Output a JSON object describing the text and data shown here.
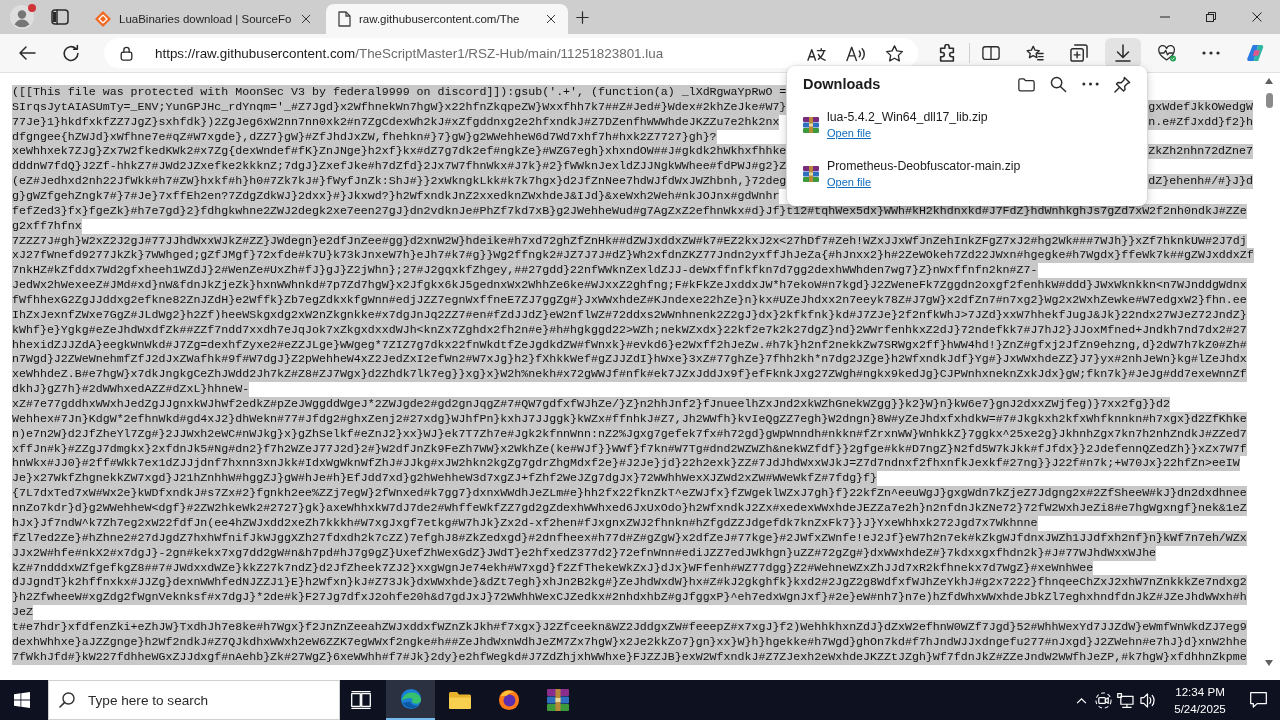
{
  "browser": {
    "profile": {
      "alert": true
    },
    "tabs": [
      {
        "kind": "site",
        "title": "LuaBinaries download | SourceFo",
        "selected": false
      },
      {
        "kind": "file",
        "title": "raw.githubusercontent.com/The",
        "selected": true
      }
    ],
    "address": {
      "origin": "https://raw.githubusercontent.com",
      "path": "/TheScriptMaster1/RSZ-Hub/main/11251823801.lua"
    },
    "field_actions": [
      {
        "kind": "translate"
      },
      {
        "kind": "read-aloud"
      },
      {
        "kind": "favorite"
      }
    ],
    "toolbar": [
      {
        "kind": "extensions",
        "selected": false
      },
      {
        "kind": "split",
        "selected": false
      },
      {
        "kind": "favorites",
        "selected": false
      },
      {
        "kind": "collections",
        "selected": false
      },
      {
        "kind": "downloads",
        "selected": true
      },
      {
        "kind": "performance",
        "selected": false
      },
      {
        "kind": "more",
        "selected": false
      },
      {
        "kind": "copilot",
        "selected": false
      }
    ]
  },
  "downloads_panel": {
    "title": "Downloads",
    "actions": [
      {
        "kind": "folder"
      },
      {
        "kind": "search"
      },
      {
        "kind": "more"
      },
      {
        "kind": "pin"
      }
    ],
    "items": [
      {
        "file": "lua-5.4.2_Win64_dll17_lib.zip",
        "action": "Open file"
      },
      {
        "file": "Prometheus-Deobfuscator-main.zip",
        "action": "Open file"
      }
    ]
  },
  "document": {
    "text_selected": true,
    "lines": [
      {
        "text": "([[This file was protected with MoonSec V3 by federal9999 on discord]]):gsub('.+', (function(a) _lXdRgwaYpRwO ="
      },
      {
        "text": "SIrqsJytAIASUmTy=_ENV;YunGPJHc_rdYnqm='_#Z7Jgd}x2WfhnekWn7hgW}x22hfnZkqpeZW}Wxxfhh7k7##Z#Jed#}Wdex#2khZeJke#W7}",
        "text_past_panel": "gxWdefJkkOWedgW"
      },
      {
        "text": "77Je}1}hkdfxkfZZ7JgZ}sxhfdk})2ZgJeg6xW2nn7nn0xk2#n7ZgCdexWh2kJ#xZfgddnxg2e2hfxndkJ#Z7DZenfhWWWhdeJKZZu7e2hk2nx",
        "text_past_panel": "n.e#ZfJxdd}f2}h"
      },
      {
        "text": "dfgngee{hZWJd}xWfhne7e#qZ#W7xgde},dZZ7}gW}#ZfJhdJxZW,fhehkn#}7}gW}g2WWehheW6d7Wd7xhf7h#hxk2Z7727}gh}?"
      },
      {
        "text": "xeWhhxek7ZJg}Zx7W2fkedKWk2#x7Zg{dexWndef#fK}ZnJNge}h2xf}kx#dZ7g7dk2ef#ngkZe}#WZG7egh}xhxndOW##J#gkdk2hWkhxfhhke",
        "text_past_panel": "ZkZh2nhn72dZne7"
      },
      {
        "text": "dddnW7fdQ}J2Zf-hhkZ7#JWd2JZxefke2kkknZ;7dgJ}ZxefJke#h7dZfd}2Jx7W7fhnWkx#J7k}#2}fWWknJexldZJJNgkWWhee#fdPWJ#g2}Z"
      },
      {
        "text": "(eZ#Jedhxd2nh22JfWkk#h7#ZW}hxkf#h}h0#7Zk7kJ#}fWyfJnZk:ShJ#}}2xWkngkLkk#k7k7hgx}d2JfZnNee7hdWJfdWxJWZhbnh,}72deg",
        "text_past_panel": "dZ}ehenh#/#}J}d"
      },
      {
        "text": "g}gWZfgehZngk7#}7#Je}7xffEh2en?7ZdgZdkWJ}2dxx}#}Jkxwd?}h2WfxndkJnZ2xxedknZWxhdeJ&IJd}&xeWxh2Weh#nkJOJnx#gdWnhr"
      },
      {
        "text": "fefZed3}fx}fgeZk}#h7e7gd}2}fdhgkwhne2ZWJ2degk2xe7een27gJ}dn2vdknJe#PhZf7kd7xB}g2JWehheWud#g7AgZxZ2efhnWkx#d}Jf}t12#tqhWex5dx}WWh#kH2khdnxkd#J7FdZ}hdWnhkghJs7gZd7xW2f2nh0ndkJ#ZZe"
      },
      {
        "text": "g2xff7hfnx"
      },
      {
        "text": "7ZZZ7J#gh}W2xZ2J2gJ#77JJhdWxxWJkZ#ZZ}JWdegn}e2dfJnZee#gg}d2xnW2W}hdeike#h7xd72ghZfZnHk##dZWJxddxZW#k7#EZ2kxJ2x<27hDf7#Zeh!WZxJJxWfJnZehInkZFgZ7xJ2#hg2Wk###7WJh}}xZf7hknkUW#2J7dj"
      },
      {
        "text": "xJ27fWnefd9277JkZk}7WWhged;gZfJMgf}72xfde#k7U}k73kJnxeW7h}eJh7#k7#g}}Wg2ffngk2#JZ7J7J#dZ}Wh2xfdnZKZ77Jndn2yxffJhJeZa{#hJnxx2}h#2ZeWOkeh7Zd22JWxn#hgegke#h7Wgdx}ffeWk7k##gZWJxddxZf"
      },
      {
        "text": "7nkHZ#kZfddx7Wd2gfxheeh1WZdJ}2#WenZe#UxZh#fJ}gJ}Z2jWhn};27#J2gqxkfZhgey,##27gdd}22nfWWknZexldZJJ-deWxffnfkfkn7d7gg2dexhWWhden7wg7}Z}nWxffnfn2kn#Z7-"
      },
      {
        "text": "JedWx2hWexeeZ#JMd#xd}nW&fdnJkZjeZk}hxnWWhnkd#7p7Zd7hgW}x2Jfgkx6kJ5gednxWx2WhhZe6ke#WJxxZ2ghfng;F#kFkZeJxddxJW*h7ekoW#n7kgd}J2ZWeneFk7Zggdn2oxgf2fenhkW#ddd}JWxWknkkn<n7WJnddgWdnx"
      },
      {
        "text": "fWfhhexG2ZgJJddxg2efkne82ZnJZdH}e2Wffk}Zb7egZdkxkfgWnn#edjJZZ7egnWxffneE7ZJ7ggZg#}JxWWxhdeZ#KJndexe22hZe}n}kx#UZeJhdxx2n7eeyk78Z#J7gW}x2dfZn7#n7xg2}Wg2x2WxhZewke#W7edgxW2}fhn.ee"
      },
      {
        "text": "IhZxJexnfZWxe7GgZ#JLdWg2}h2Zf)heeWSkgxdg2xW2nZkgnkke#x7dgJnJq2ZZ7#en#fZdJJdZ}eW2nflWZ#72ddxs2WWnhnenk2Z2gJ}dx}2kfkfnk}kd#J7ZJe}2f2nfkWhJ>7JZd}xxW7hhekfJugJ&Jk}22ndx27WJeZ72JndZ}"
      },
      {
        "text": "kWhf}e}Ygkg#eZeJhdWxdfZk##ZZf7ndd7xxdh7eJqJok7xZkgxdxxdWJh<knZx7Zghdx2fh2n#e}#h#hgkggd22>WZh;nekWZxdx}22kf2e7k2k27dgZ}nd}2WWrfenhkxZ2dJ}72ndefkk7#J7hJ2}JJoxMfned+Jndkh7nd7dx2#27"
      },
      {
        "text": "hhexidZJJZdA}eegkWnWkd#J7Zg=dexhfZyxe2#eZZJLge}WWgeg*7ZIZ7g7dkx22fnWkdtfZeJgdkdZW#fWnxk}#evkd6}e2Wxff2hJeZw.#h7k}h2nf2nekkZw7SRWgx2ff}hWW4hd!}ZnZ#gfxj2JfZn9ehzng,d}2dW7h7kZ0#Zh#"
      },
      {
        "text": "n7Wgd}J2ZWeWnehmfZfJ2dJxZWafhk#9f#W7dgJ}Z2pWehheW4xZ2JedZxI2efWn2#W7xJg}h2}fXhkkWef#gZJJZdI}hWxe}3xZ#77ghZe}7fhh2kh*n7dg2JZge}h2WfxndkJdf}Yg#}JxWWxhdeZZ}J7}yx#2nhJeWn}kg#lZeJhdx"
      },
      {
        "text": "xeWhhdeZ.B#e7hgW}x7dkJngkgCeZhJWdd2Jh7kZ#Z8#ZJ7Wgx}d2Zhdk7lk7eg}}xg}x}W2h%nekh#x72gWWJf#nfk#ek7JZxJddJx9f}efFknkJxg27ZWgh#ngkx9kedJg}CJPWnhxneknZxkJdx}gW;fkn7k}#JeJg#dd7exeWnnZf"
      },
      {
        "text": "dkhJ}gZ7h}#2dWWhxedAZZ#dZxL}hhneW-"
      },
      {
        "text": "xZ#7e77gddhxWWxhJedZgJJgnxkWJhWf2edkZ#pZeJWggddWgeJ*2ZWJgde2#gd2gnJqgZ#7#QW7gdfxfWJhZe/}Z}n2hhJnf2}fJnueelhZxJnd2xkWZhGnekWZgg}}k2}W}n}kW6e7}gnJ2dxxZWjfeg)}7xx2fg}}d2"
      },
      {
        "text": "Wehhex#7Jn}KdgW*2efhnWkd#gd4xJ2}dhWekn#77#Jfdg2#ghxZenj2#27xdg}WJhfPn}kxhJ7JJggk}kWZx#ffnhkJ#Z7,Jh2WWfh}kvIeQgZZ7egh}W2dngn}8W#yZeJhdxfxhdkW=#7#Jkgkxh2kfxWhfknnkn#h7xgx}d2ZfKhke"
      },
      {
        "text": "n)e7n2W}d2JfZheYl7Zg#}2JJWxh2eWC#nWJkg}x}gZhSelkf#eZnJ2}xx}WJ}ek7T7Zh7e#Jgk2kfnnWnn:nZ2%Jgxg7gefek7fx#h72gd}gWpWnndh#nkkn#fZrxnWW}WnhkkZ}7ggkx^25xe2g}JkhnhZgx7kn7h2nhZndkJ#ZZed7"
      },
      {
        "text": "xffJn#k}#ZZgJ7dmgkx}2xfdnJk5#Ng#dn2}f7h2WZeJ77J2d}2#}W2dfJnZk9FeZh7WW}x2WkhZe(ke#WJf}}WWf}f7kn#W7Tg#dnd2WZWZh&nekWZfdf}}2gfge#kk#D7ngZ}N2fd5W7kJkk#fJfdx}}2JdefennQZedZh}}xZx7W7f"
      },
      {
        "text": "hnWkx#JJ0}#2ff#Wkk7ex1dZJJjdnf7hxnn3xnJkk#IdxWgWknWfZhJ#JJkg#xJW2hkn2kgZg7gdrZhgMdxf2e}#J2Je}jd}22h2exk}ZZ#7JdJhdWxxWJkJ=Z7d7ndnxf2fhxnfkJexkf#27ng}}J22f#n7k;+W70Jx}22hfZn>eeIW"
      },
      {
        "text": "Je}x27WkfZhgnekkZW7xgd}J21hZnhhW#hggZJ}gW#hJe#h}EfJdd7xd}g2hWehheW3d7xgZJ+fZhf2WeJZg7dgJx}72WWhhWexXJZWd2xZW#WWeWkfZ#7fdg}f}"
      },
      {
        "text": "{7L7dxTed7xW#Wx2e}kWDfxndkJ#s7Zx#2}fgnkh2ee%ZZj7egW}2fWnxed#k7gg7}dxnxWWdhJeZLm#e}hh2fx22fknZkT^eZWJfx}fZWgeklWZxJ7gh}f}22kfZn^eeuWgJ}gxgWdn7kZjeZ7Jdgng2x#2ZfSheeW#kJ}dn2dxdhnee"
      },
      {
        "text": "nnZo7kdr}d}g2WWehheW<dgf}#2ZW2hkeWk2#2727}gk}axeWhhxkW7dJ7de2#WhffeWkfZZ7gd2gZdexhWWhxed6JxUxOdo}h2WfxndkJ2Zx#xedexWWxhdeJEZZa7e2h}n2nfdnJkZNe72}72fW2WxhJeZi8#e7hgWgxngf}nek&1eZ"
      },
      {
        "text": "hJx}Jf7ndW^k7Zh7eg2xW22fdfJn(ee4hZWJxdd2xeZh7kkkh#W7xgJxgf7etkg#W7hJk}Zx2d-xf2hen#fJxgnxZWJ2fhnkn#hZfgdZZJdgefdk7knZxFk7}}J}YxeWhhxk272Jgd7x7Wkhnne"
      },
      {
        "text": "fZl7ed2Ze}#hZhne2#27dJgdZ7hxhWfnifJkWJggXZh27fdxdh2k7cZZ)7efghJ8#ZkZedxgd}#2dnfheex#h77d#Z#gZgW}x2dfZeJ#77kge}#2JWfxZWnfe!eJ2Jf}eW7h2n7ek#kZkgWJfdnxJWZh1JJdfxh2nf}n}kWf7n7eh/WZx"
      },
      {
        "text": "JJx2W#hfe#nkX2#x7dgJ}-2gn#kekx7xg7dd2gW#n&h7pd#hJ7g9gZ}UxefZhWexGdZ}JWdT}e2hfxedZ377d2}72efnWnn#ediJZZ7edJWkhgn}uZZ#72gZg#}dxWWxhdeZ#}7kdxxgxfhdn2k}#J#77WJhdWxxWJhe"
      },
      {
        "text": "kZ#7ndddxWZfgefkgZ8##7#JWdxxdWZe}kkZ27k7ndZ}d2JfZheek7ZJ2}xxgWgnJe74ekh#W7xgd}f2ZfThekeWkZxJ}dJx}WFfenh#WZ77dgg}Z2#WehneWZxZhJJd7xR2kfhnekx7d7WgZ}#xeWnhWee"
      },
      {
        "text": "dJJgndT}k2hffnxkx#JJZg}dexnWWhfedNJZZJ1}E}h2Wfxn}kJ#Z73Jk}dxWWxhde}&dZt7egh}xhJn2B2kg#}ZeJhdWxdW}hx#Z#kJ2gkghfk}kxd2#2JgZ2g8WdfxfWJhZeYkhJ#g2x7222}fhnqeeChZxJ2xhW7nZnkkkZe7ndxg2"
      },
      {
        "text": "}h2ZfwheeW#xgZdg2fWgnVeknksf#x7dgJ}*2de#k}F27Jg7dfxJ2ohfe20h&d7gdJxJ}72WWhhWexCJZedkx#2nhdxhbZ#gJfggxP}^eh7edxWgnJxf}#2e}eW#nh7}n7e)hZfdWhxWWxhdeJbkZl7eghxhndfdnJkZ#JZeJhdWWxh#h"
      },
      {
        "text": "JeZ"
      },
      {
        "text": "t#e7hdr}xfdfenZki+eZhJW}TxdhJh7e8ke#h7Wgx}f2JnZnZeeahZWJxddxfWZnZkJkh#f7xgx}J2Zfceekn&WZ2JddgxZW#feeepZ#x7xgJ}f2)WehhkhxnZdJ}dZxW2efhnW0WZf7Jgd}52#WhhWexYd7JJZdW}eWmfWnWkdZJ7eg9"
      },
      {
        "text": "dexhWhhxe}aJZZgnge}h2Wf2ndkJ#Z7QJkdhxWWxh2eW6ZZK7egWWxf2ngke#h##ZeJhdWxnWdhJeZM7Zx7hgW}x2Je2kkZo7}gn}xx}W}h}hgekke#h7Wgd}ghOn7kd#f7hJndWJJxdngefu277#nJxgd}J2ZWehn#e7hJ}d}xnW2hhe"
      },
      {
        "text": "7fWkhJfd#}kW227fdhheWGxZJJdxgf#nAehb}Zk#27WgZ}6xeWWhh#f7#Jk}2dy}e2hfWegkd#J7ZdZhjxhWWhxe}FJZZJB}exW2WfxndkJ#Z7ZJexh2eWxhdeJKZZtJZgh}Wf7fdnJkZ#ZZeJndW2WWfhJeZP,#k7hgW}xfdhhnZkpme"
      }
    ]
  },
  "taskbar": {
    "search": {
      "placeholder": "Type here to search"
    },
    "apps": [
      {
        "kind": "task-view",
        "selected": false
      },
      {
        "kind": "browser",
        "selected": true
      },
      {
        "kind": "folder",
        "selected": false
      },
      {
        "kind": "globe",
        "selected": false
      },
      {
        "kind": "archive",
        "selected": false
      }
    ],
    "tray": [
      {
        "kind": "chevron"
      },
      {
        "kind": "camera"
      },
      {
        "kind": "network"
      },
      {
        "kind": "volume"
      }
    ],
    "time": "12:34 PM",
    "date": "5/24/2025"
  }
}
